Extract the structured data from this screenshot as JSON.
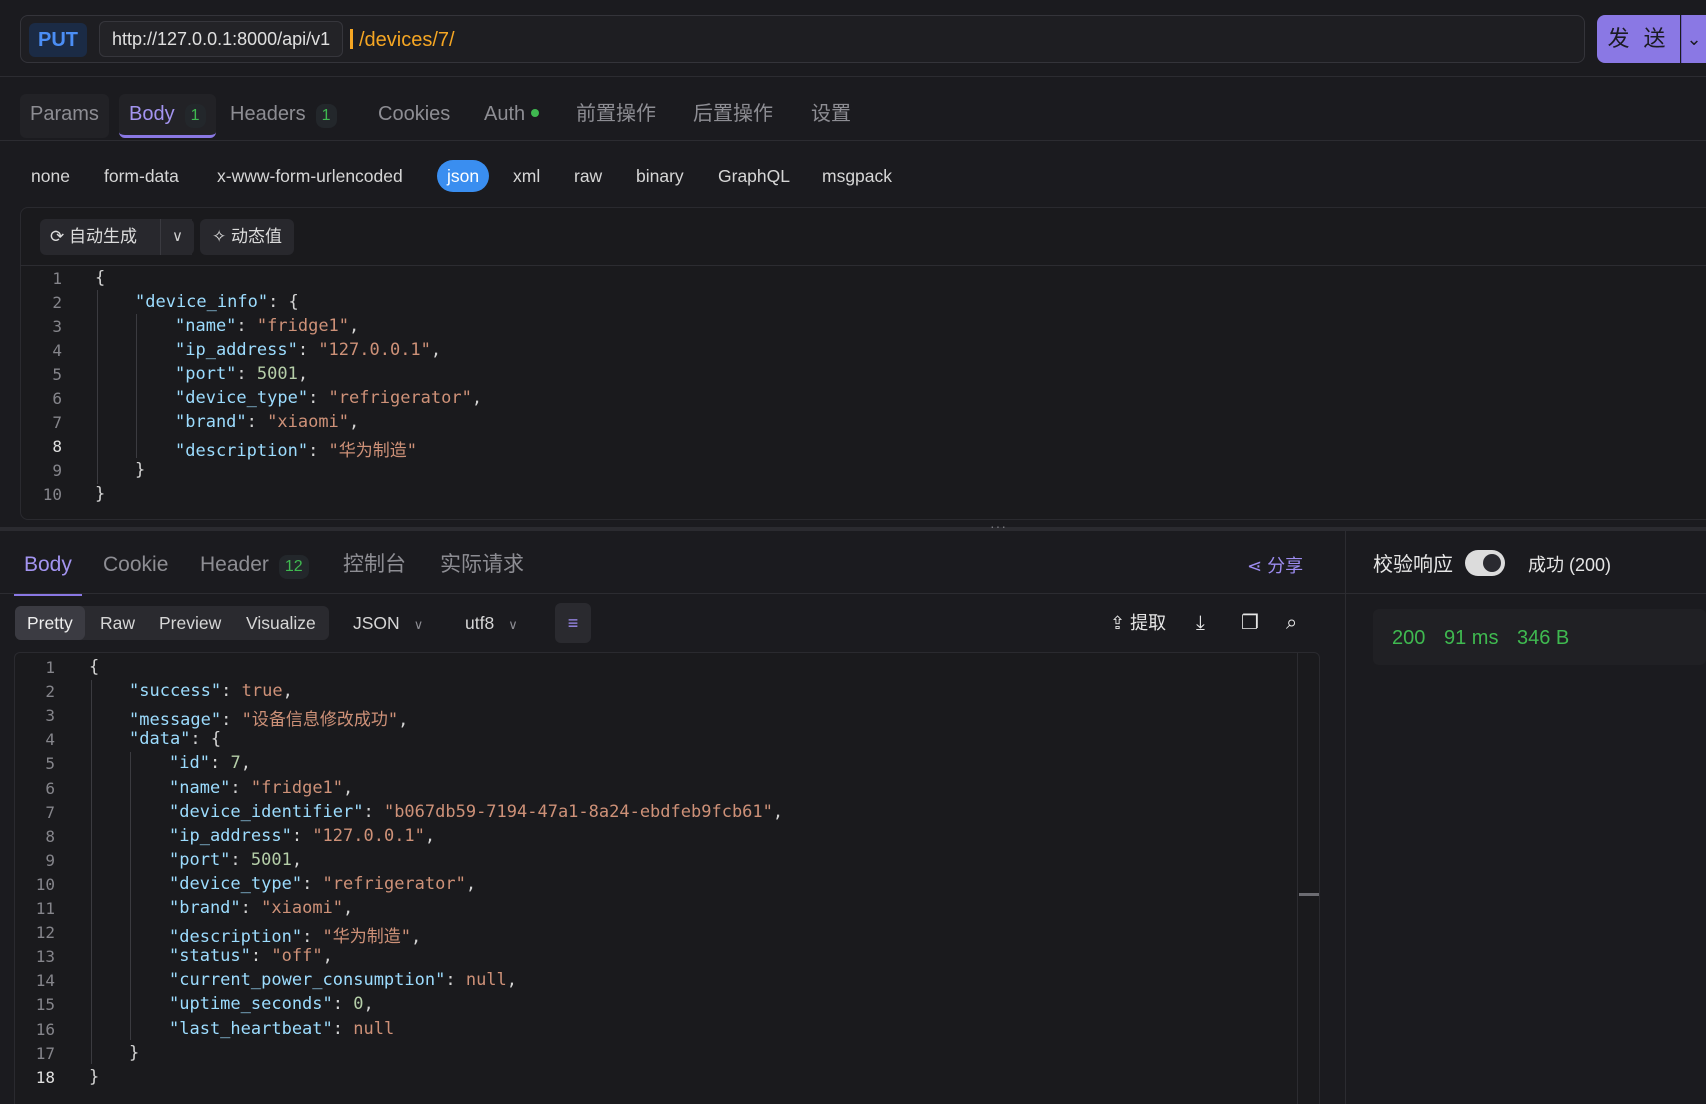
{
  "request": {
    "method": "PUT",
    "base_url": "http://127.0.0.1:8000/api/v1",
    "path": "/devices/7/",
    "send_label": "发 送"
  },
  "request_tabs": [
    {
      "label": "Params"
    },
    {
      "label": "Body",
      "count": "1"
    },
    {
      "label": "Headers",
      "count": "1"
    },
    {
      "label": "Cookies"
    },
    {
      "label": "Auth"
    },
    {
      "label": "前置操作"
    },
    {
      "label": "后置操作"
    },
    {
      "label": "设置"
    }
  ],
  "body_types": [
    "none",
    "form-data",
    "x-www-form-urlencoded",
    "json",
    "xml",
    "raw",
    "binary",
    "GraphQL",
    "msgpack"
  ],
  "selected_body_type": "json",
  "editor_toolbar": {
    "auto_generate": "自动生成",
    "dynamic_value": "动态值"
  },
  "request_body_lines": [
    {
      "n": "1",
      "tokens": [
        [
          "p",
          "{"
        ]
      ]
    },
    {
      "n": "2",
      "tokens": [
        [
          "k",
          "\"device_info\""
        ],
        [
          "p",
          ": {"
        ]
      ]
    },
    {
      "n": "3",
      "tokens": [
        [
          "k",
          "\"name\""
        ],
        [
          "p",
          ": "
        ],
        [
          "s",
          "\"fridge1\""
        ],
        [
          "p",
          ","
        ]
      ]
    },
    {
      "n": "4",
      "tokens": [
        [
          "k",
          "\"ip_address\""
        ],
        [
          "p",
          ": "
        ],
        [
          "s",
          "\"127.0.0.1\""
        ],
        [
          "p",
          ","
        ]
      ]
    },
    {
      "n": "5",
      "tokens": [
        [
          "k",
          "\"port\""
        ],
        [
          "p",
          ": "
        ],
        [
          "n",
          "5001"
        ],
        [
          "p",
          ","
        ]
      ]
    },
    {
      "n": "6",
      "tokens": [
        [
          "k",
          "\"device_type\""
        ],
        [
          "p",
          ": "
        ],
        [
          "s",
          "\"refrigerator\""
        ],
        [
          "p",
          ","
        ]
      ]
    },
    {
      "n": "7",
      "tokens": [
        [
          "k",
          "\"brand\""
        ],
        [
          "p",
          ": "
        ],
        [
          "s",
          "\"xiaomi\""
        ],
        [
          "p",
          ","
        ]
      ]
    },
    {
      "n": "8",
      "tokens": [
        [
          "k",
          "\"description\""
        ],
        [
          "p",
          ": "
        ],
        [
          "s",
          "\"华为制造\""
        ]
      ]
    },
    {
      "n": "9",
      "tokens": [
        [
          "p",
          "}"
        ]
      ]
    },
    {
      "n": "10",
      "tokens": [
        [
          "p",
          "}"
        ]
      ]
    }
  ],
  "response_tabs": [
    {
      "label": "Body"
    },
    {
      "label": "Cookie"
    },
    {
      "label": "Header",
      "count": "12"
    },
    {
      "label": "控制台"
    },
    {
      "label": "实际请求"
    }
  ],
  "share_label": "分享",
  "view_modes": [
    "Pretty",
    "Raw",
    "Preview",
    "Visualize"
  ],
  "format_select": "JSON",
  "encoding_select": "utf8",
  "extract_label": "提取",
  "validate_label": "校验响应",
  "status_text": "成功 (200)",
  "metrics": {
    "status": "200",
    "time": "91 ms",
    "size": "346 B"
  },
  "response_body_lines": [
    {
      "n": "1",
      "tokens": [
        [
          "p",
          "{"
        ]
      ]
    },
    {
      "n": "2",
      "tokens": [
        [
          "k",
          "\"success\""
        ],
        [
          "p",
          ": "
        ],
        [
          "kw",
          "true"
        ],
        [
          "p",
          ","
        ]
      ]
    },
    {
      "n": "3",
      "tokens": [
        [
          "k",
          "\"message\""
        ],
        [
          "p",
          ": "
        ],
        [
          "s",
          "\"设备信息修改成功\""
        ],
        [
          "p",
          ","
        ]
      ]
    },
    {
      "n": "4",
      "tokens": [
        [
          "k",
          "\"data\""
        ],
        [
          "p",
          ": {"
        ]
      ]
    },
    {
      "n": "5",
      "tokens": [
        [
          "k",
          "\"id\""
        ],
        [
          "p",
          ": "
        ],
        [
          "n",
          "7"
        ],
        [
          "p",
          ","
        ]
      ]
    },
    {
      "n": "6",
      "tokens": [
        [
          "k",
          "\"name\""
        ],
        [
          "p",
          ": "
        ],
        [
          "s",
          "\"fridge1\""
        ],
        [
          "p",
          ","
        ]
      ]
    },
    {
      "n": "7",
      "tokens": [
        [
          "k",
          "\"device_identifier\""
        ],
        [
          "p",
          ": "
        ],
        [
          "s",
          "\"b067db59-7194-47a1-8a24-ebdfeb9fcb61\""
        ],
        [
          "p",
          ","
        ]
      ]
    },
    {
      "n": "8",
      "tokens": [
        [
          "k",
          "\"ip_address\""
        ],
        [
          "p",
          ": "
        ],
        [
          "s",
          "\"127.0.0.1\""
        ],
        [
          "p",
          ","
        ]
      ]
    },
    {
      "n": "9",
      "tokens": [
        [
          "k",
          "\"port\""
        ],
        [
          "p",
          ": "
        ],
        [
          "n",
          "5001"
        ],
        [
          "p",
          ","
        ]
      ]
    },
    {
      "n": "10",
      "tokens": [
        [
          "k",
          "\"device_type\""
        ],
        [
          "p",
          ": "
        ],
        [
          "s",
          "\"refrigerator\""
        ],
        [
          "p",
          ","
        ]
      ]
    },
    {
      "n": "11",
      "tokens": [
        [
          "k",
          "\"brand\""
        ],
        [
          "p",
          ": "
        ],
        [
          "s",
          "\"xiaomi\""
        ],
        [
          "p",
          ","
        ]
      ]
    },
    {
      "n": "12",
      "tokens": [
        [
          "k",
          "\"description\""
        ],
        [
          "p",
          ": "
        ],
        [
          "s",
          "\"华为制造\""
        ],
        [
          "p",
          ","
        ]
      ]
    },
    {
      "n": "13",
      "tokens": [
        [
          "k",
          "\"status\""
        ],
        [
          "p",
          ": "
        ],
        [
          "s",
          "\"off\""
        ],
        [
          "p",
          ","
        ]
      ]
    },
    {
      "n": "14",
      "tokens": [
        [
          "k",
          "\"current_power_consumption\""
        ],
        [
          "p",
          ": "
        ],
        [
          "kw",
          "null"
        ],
        [
          "p",
          ","
        ]
      ]
    },
    {
      "n": "15",
      "tokens": [
        [
          "k",
          "\"uptime_seconds\""
        ],
        [
          "p",
          ": "
        ],
        [
          "n",
          "0"
        ],
        [
          "p",
          ","
        ]
      ]
    },
    {
      "n": "16",
      "tokens": [
        [
          "k",
          "\"last_heartbeat\""
        ],
        [
          "p",
          ": "
        ],
        [
          "kw",
          "null"
        ]
      ]
    },
    {
      "n": "17",
      "tokens": [
        [
          "p",
          "}"
        ]
      ]
    },
    {
      "n": "18",
      "tokens": [
        [
          "p",
          "}"
        ]
      ]
    }
  ],
  "colors": {
    "accent": "#8a78e4",
    "method": "#4b8ef5",
    "path": "#f5a623",
    "success": "#3fb950",
    "json_chip": "#3a8ef0"
  }
}
